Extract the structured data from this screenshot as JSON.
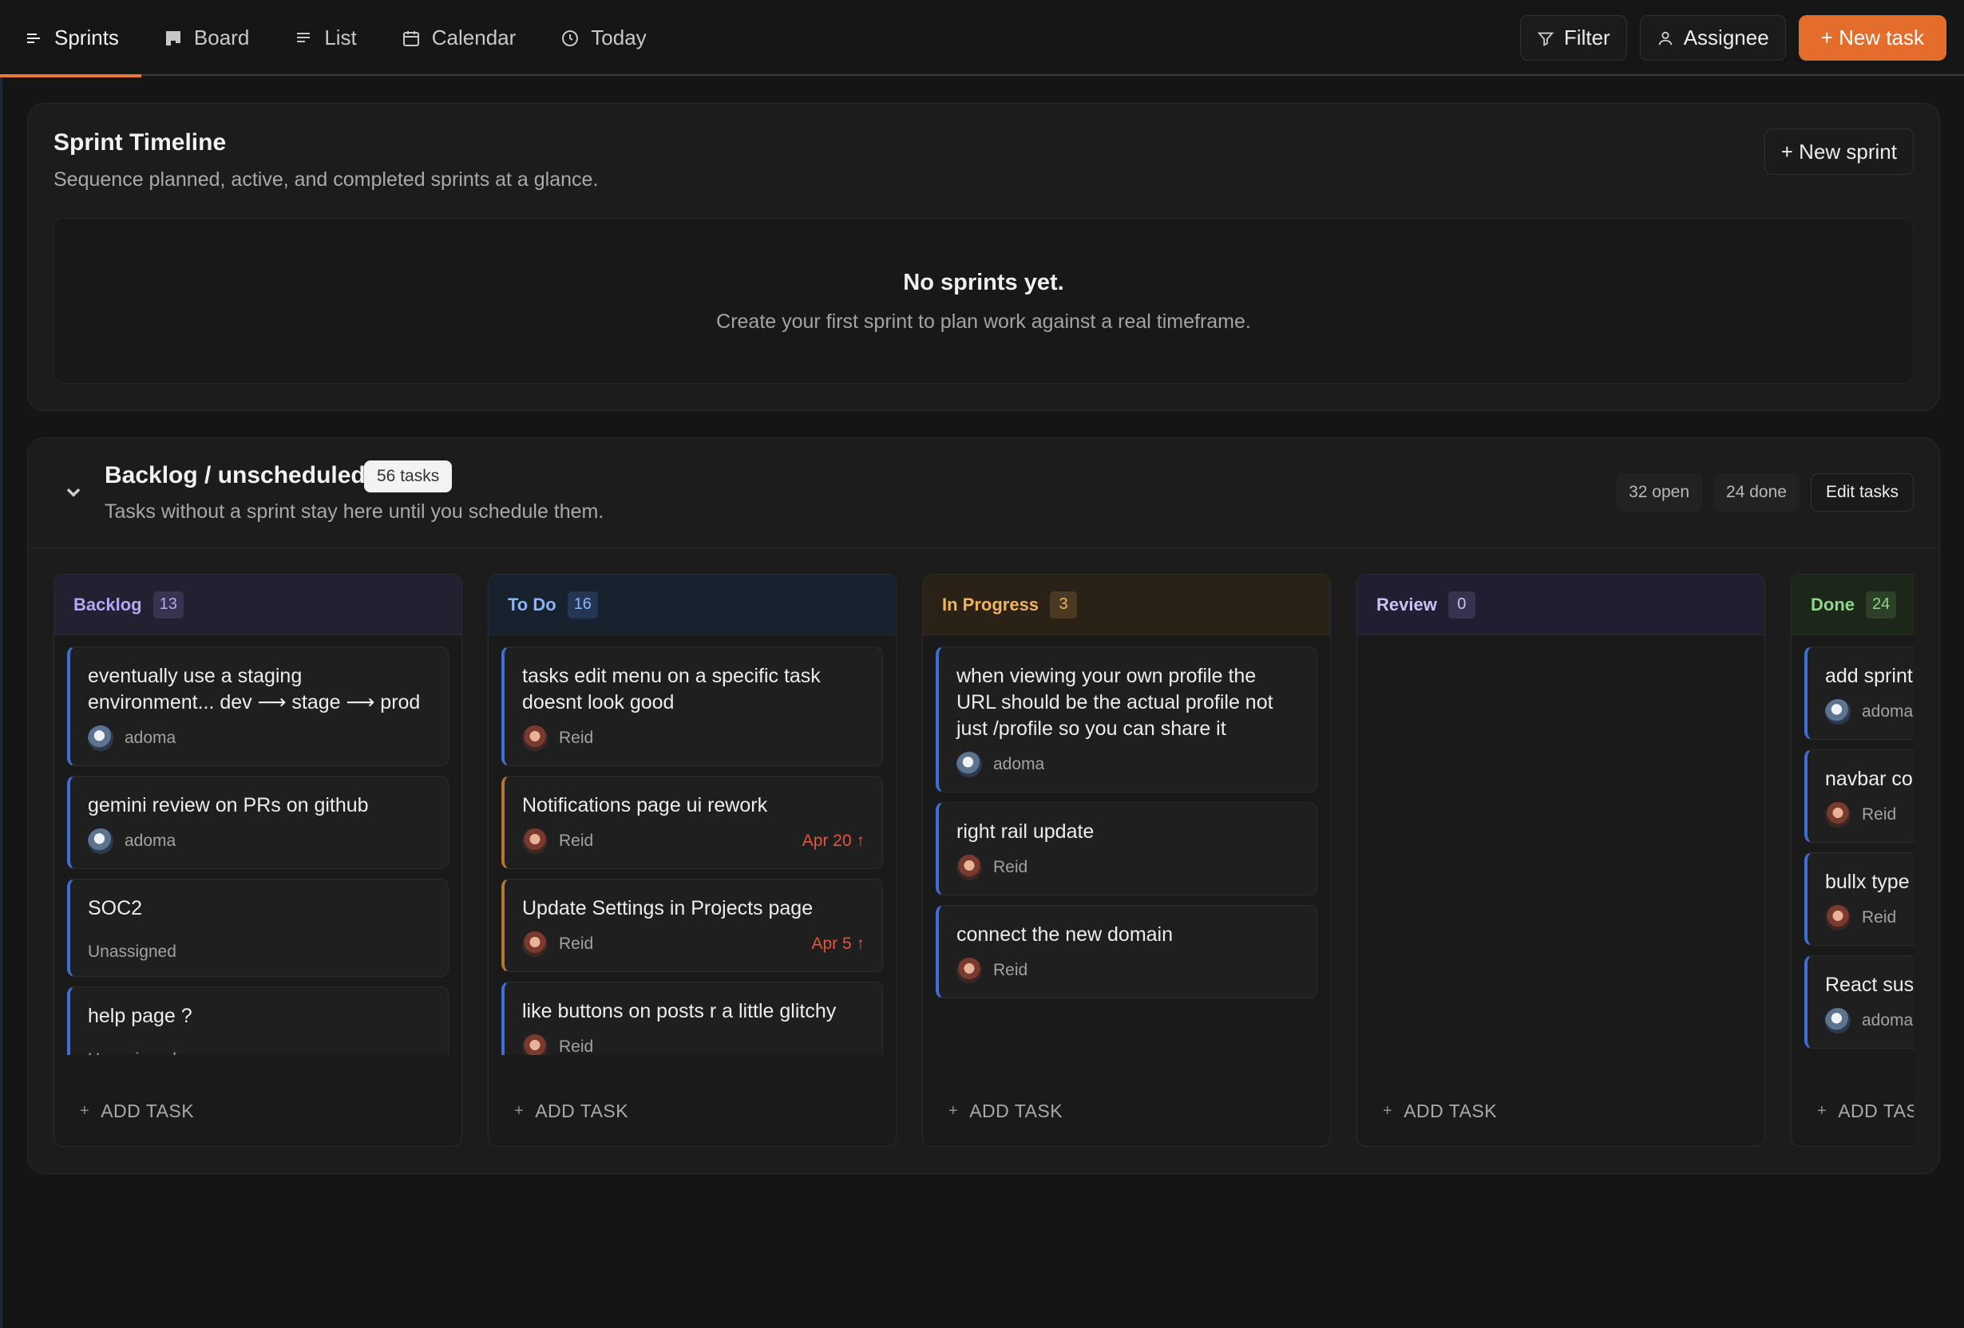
{
  "nav": {
    "tabs": [
      {
        "label": "Sprints",
        "icon": "sprints-icon",
        "active": true
      },
      {
        "label": "Board",
        "icon": "board-icon",
        "active": false
      },
      {
        "label": "List",
        "icon": "list-icon",
        "active": false
      },
      {
        "label": "Calendar",
        "icon": "calendar-icon",
        "active": false
      },
      {
        "label": "Today",
        "icon": "clock-icon",
        "active": false
      }
    ],
    "filter_label": "Filter",
    "assignee_label": "Assignee",
    "new_task_label": "+ New task",
    "accent_color": "#e56d2c"
  },
  "timeline": {
    "title": "Sprint Timeline",
    "subtitle": "Sequence planned, active, and completed sprints at a glance.",
    "new_sprint_label": "+ New sprint",
    "empty_title": "No sprints yet.",
    "empty_text": "Create your first sprint to plan work against a real timeframe."
  },
  "backlog": {
    "title": "Backlog / unscheduled",
    "badge": "56 tasks",
    "subtitle": "Tasks without a sprint stay here until you schedule them.",
    "open": "32 open",
    "done": "24 done",
    "edit_label": "Edit tasks",
    "add_task_label": "ADD TASK",
    "columns": [
      {
        "name": "Backlog",
        "count": "13",
        "color": "#b7a6f2",
        "bg": "#241f31",
        "count_bg": "#3a3350",
        "cards": [
          {
            "title": "eventually use a staging environment... dev ⟶ stage ⟶ prod",
            "assignee": "adoma",
            "avatar": "adoma"
          },
          {
            "title": "gemini review on PRs on github",
            "assignee": "adoma",
            "avatar": "adoma"
          },
          {
            "title": "SOC2",
            "assignee": "Unassigned",
            "avatar": ""
          },
          {
            "title": "help page ?",
            "assignee": "Unassigned",
            "avatar": ""
          }
        ]
      },
      {
        "name": "To Do",
        "count": "16",
        "color": "#8ab4f8",
        "bg": "#18222f",
        "count_bg": "#243651",
        "cards": [
          {
            "title": "tasks edit menu on a specific task doesnt look good",
            "assignee": "Reid",
            "avatar": "reid"
          },
          {
            "title": "Notifications page ui rework",
            "assignee": "Reid",
            "avatar": "reid",
            "due": "Apr 20 ↑",
            "accent": "orange"
          },
          {
            "title": "Update Settings in Projects page",
            "assignee": "Reid",
            "avatar": "reid",
            "due": "Apr 5 ↑",
            "accent": "orange"
          },
          {
            "title": "like buttons on posts r a little glitchy",
            "assignee": "Reid",
            "avatar": "reid"
          }
        ]
      },
      {
        "name": "In Progress",
        "count": "3",
        "color": "#f0b35e",
        "bg": "#2a2217",
        "count_bg": "#4a3a22",
        "cards": [
          {
            "title": "when viewing your own profile the URL should be the actual profile not just /profile so you can share it",
            "assignee": "adoma",
            "avatar": "adoma"
          },
          {
            "title": "right rail update",
            "assignee": "Reid",
            "avatar": "reid"
          },
          {
            "title": "connect the new domain",
            "assignee": "Reid",
            "avatar": "reid"
          }
        ]
      },
      {
        "name": "Review",
        "count": "0",
        "color": "#c9c3f5",
        "bg": "#201e30",
        "count_bg": "#36334f",
        "cards": []
      },
      {
        "name": "Done",
        "count": "24",
        "color": "#8fd58a",
        "bg": "#1c2719",
        "count_bg": "#2c4128",
        "cards": [
          {
            "title": "add sprint",
            "assignee": "adoma",
            "avatar": "adoma"
          },
          {
            "title": "navbar co",
            "assignee": "Reid",
            "avatar": "reid"
          },
          {
            "title": "bullx type",
            "assignee": "Reid",
            "avatar": "reid"
          },
          {
            "title": "React sus",
            "assignee": "adoma",
            "avatar": "adoma"
          }
        ]
      }
    ]
  }
}
